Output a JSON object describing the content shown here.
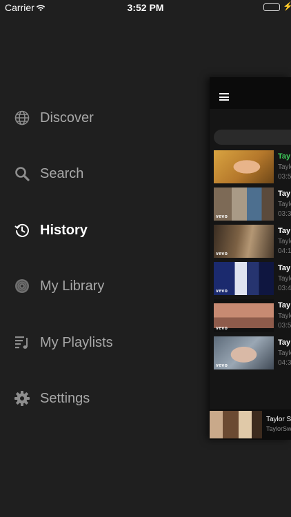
{
  "status_bar": {
    "carrier": "Carrier",
    "time": "3:52 PM"
  },
  "menu": {
    "active": "history",
    "items": [
      {
        "id": "discover",
        "label": "Discover",
        "icon": "globe-icon"
      },
      {
        "id": "search",
        "label": "Search",
        "icon": "search-icon"
      },
      {
        "id": "history",
        "label": "History",
        "icon": "history-icon"
      },
      {
        "id": "library",
        "label": "My Library",
        "icon": "disc-icon"
      },
      {
        "id": "playlists",
        "label": "My Playlists",
        "icon": "playlist-icon"
      },
      {
        "id": "settings",
        "label": "Settings",
        "icon": "gear-icon"
      }
    ]
  },
  "panel": {
    "videos": [
      {
        "title": "Tay",
        "artist": "Taylo",
        "duration": "03:5",
        "playing": true,
        "vevo": ""
      },
      {
        "title": "Tay",
        "artist": "Taylo",
        "duration": "03:3",
        "playing": false,
        "vevo": "vevo"
      },
      {
        "title": "Tay",
        "artist": "Taylo",
        "duration": "04:1",
        "playing": false,
        "vevo": "vevo"
      },
      {
        "title": "Tay",
        "artist": "Taylo",
        "duration": "03:4",
        "playing": false,
        "vevo": "vevo"
      },
      {
        "title": "Tay",
        "artist": "Taylo",
        "duration": "03:5",
        "playing": false,
        "vevo": "vevo"
      },
      {
        "title": "Tay",
        "artist": "Taylo",
        "duration": "04:3",
        "playing": false,
        "vevo": "vevo"
      }
    ],
    "now_playing": {
      "title": "Taylor S",
      "artist": "TaylorSwi"
    }
  },
  "colors": {
    "accent": "#3fcf5c",
    "menu_text": "#a8a8a8",
    "background": "#1f1f1f"
  }
}
